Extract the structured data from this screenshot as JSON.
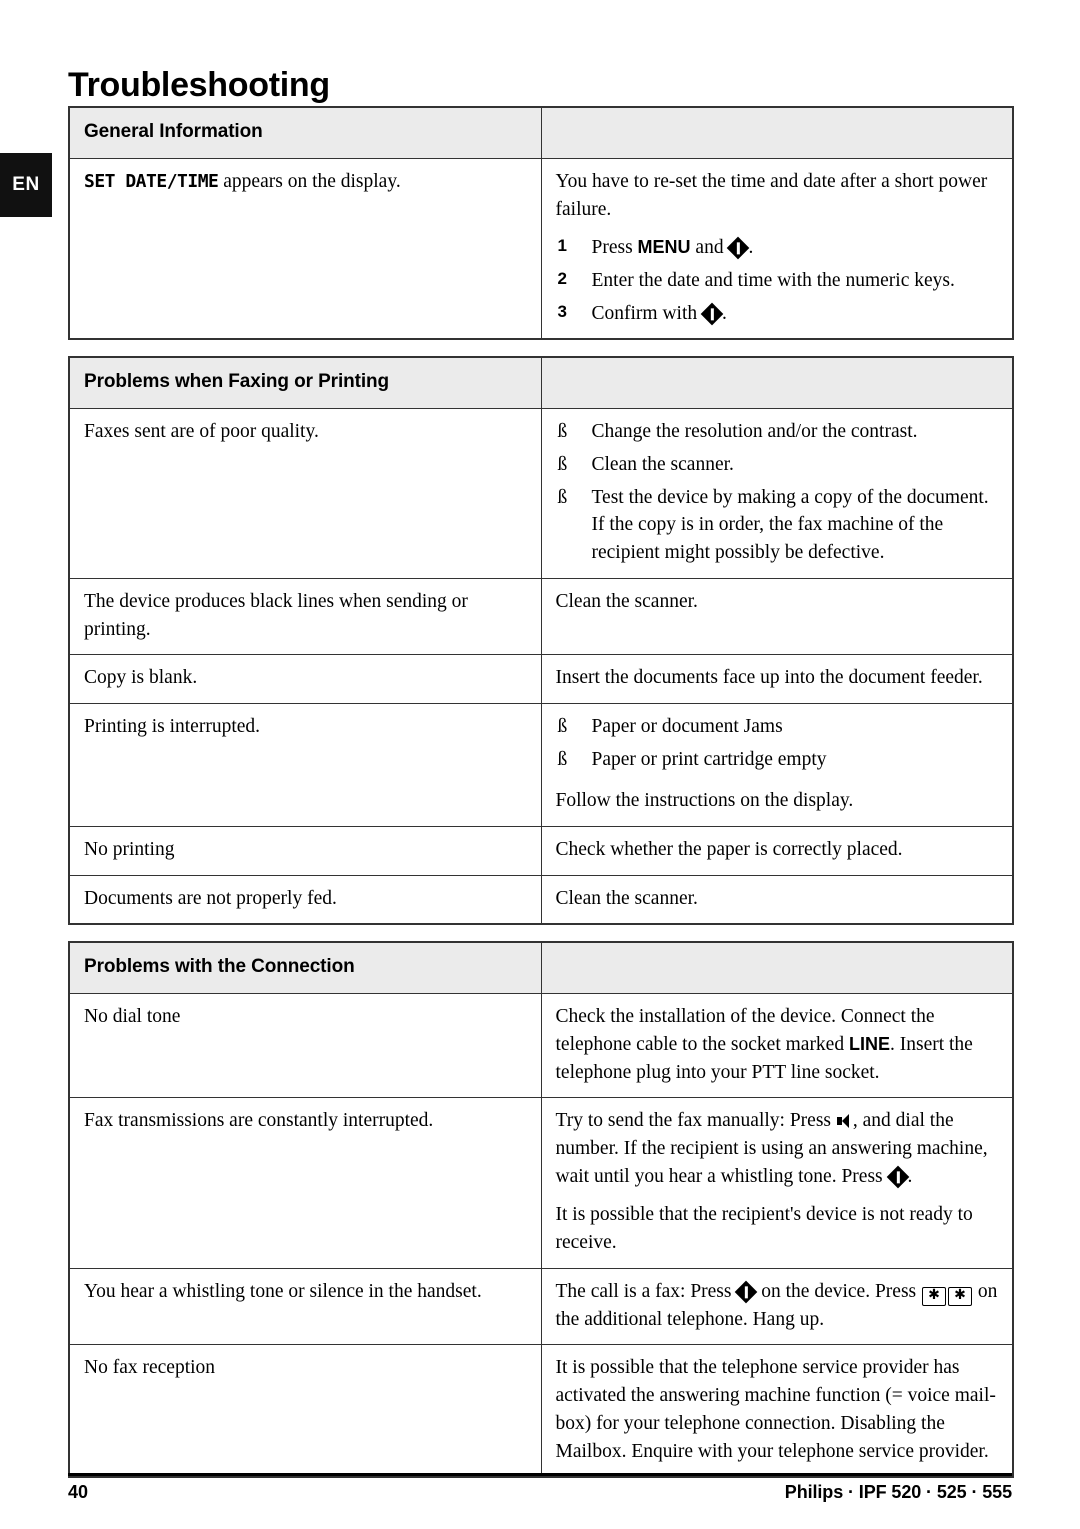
{
  "page": {
    "title": "Troubleshooting",
    "language_tab": "EN",
    "footer_page_number": "40",
    "footer_product": "Philips · IPF 520 · 525 · 555"
  },
  "icons": {
    "start_button": "start-diamond-icon",
    "speaker": "loudspeaker-icon",
    "star_key": "✱"
  },
  "tables": [
    {
      "header_left": "General Information",
      "header_right": "",
      "rows": [
        {
          "problem_prefix_lcd": "SET DATE/TIME",
          "problem": " appears on the display.",
          "solution_intro": "You have to re-set the time and date after a short power failure.",
          "steps": [
            {
              "n": "1",
              "text_before": "Press ",
              "bold": "MENU",
              "text_mid": " and ",
              "icon": "start-diamond-icon",
              "text_after": "."
            },
            {
              "n": "2",
              "text_before": "Enter the date and time with the numeric keys.",
              "bold": "",
              "text_mid": "",
              "icon": "",
              "text_after": ""
            },
            {
              "n": "3",
              "text_before": "Confirm with ",
              "bold": "",
              "text_mid": "",
              "icon": "start-diamond-icon",
              "text_after": "."
            }
          ]
        }
      ]
    },
    {
      "header_left": "Problems when Faxing or Printing",
      "header_right": "",
      "rows": [
        {
          "problem": "Faxes sent are of poor quality.",
          "bullets": [
            "Change the resolution and/or the contrast.",
            "Clean the scanner.",
            "Test the device by making a copy of the document. If the copy is in order, the fax machine of the recipient might possibly be defective."
          ],
          "bullet_marker": "ß"
        },
        {
          "problem": "The device produces black lines when sending or printing.",
          "solution": "Clean the scanner."
        },
        {
          "problem": "Copy is blank.",
          "solution": "Insert the documents face up into the document feeder."
        },
        {
          "problem": "Printing is interrupted.",
          "bullets": [
            "Paper or document Jams",
            "Paper or print cartridge empty"
          ],
          "bullet_marker": "ß",
          "solution_after": "Follow the instructions on the display."
        },
        {
          "problem": "No printing",
          "solution": "Check whether the paper is correctly placed."
        },
        {
          "problem": "Documents are not properly fed.",
          "solution": "Clean the scanner."
        }
      ]
    },
    {
      "header_left": "Problems with the Connection",
      "header_right": "",
      "rows": [
        {
          "problem": "No dial tone",
          "solution_a": "Check the installation of the device. Connect the telephone cable to the socket marked ",
          "solution_bold": "LINE",
          "solution_b": ". Insert the telephone plug into your PTT line socket."
        },
        {
          "problem": "Fax transmissions are constantly interrupted.",
          "solution_a": "Try to send the fax manually: Press ",
          "solution_b": ", and dial the number. If the recipient is using an answering machine, wait until you hear a whistling tone. Press ",
          "solution_c": ".",
          "solution_second": "It is possible that the recipient's device is not ready to receive."
        },
        {
          "problem": "You hear a whistling tone or silence in the handset.",
          "solution_a": "The call is a fax: Press ",
          "solution_b": " on the device. Press ",
          "solution_c": " on the additional telephone. Hang up."
        },
        {
          "problem": "No fax reception",
          "solution": "It is possible that the telephone service provider has activated the answering machine function (= voice mail-box) for your telephone connection. Disabling the Mailbox. Enquire with your telephone service provider."
        }
      ]
    }
  ]
}
